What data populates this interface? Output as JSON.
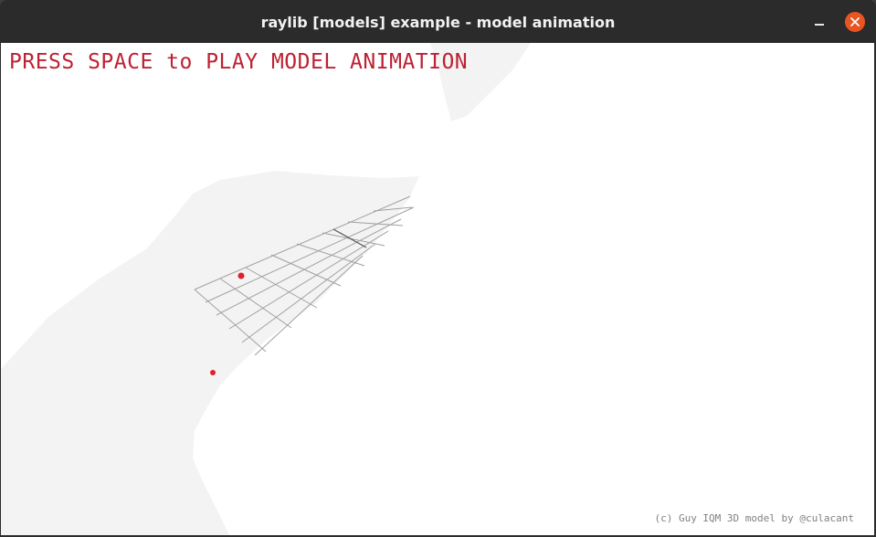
{
  "window": {
    "title": "raylib [models] example - model animation",
    "minimize_icon": "minimize-icon",
    "close_icon": "close-icon",
    "accent_color": "#e95420"
  },
  "viewport": {
    "instruction": "PRESS SPACE to PLAY MODEL ANIMATION",
    "instruction_color": "#be2133",
    "credits": "(c) Guy IQM 3D model by @culacant",
    "background_color": "#ffffff",
    "model_color": "#f3f3f3",
    "grid_color": "#9a9a9a",
    "point_color": "#e02030"
  }
}
